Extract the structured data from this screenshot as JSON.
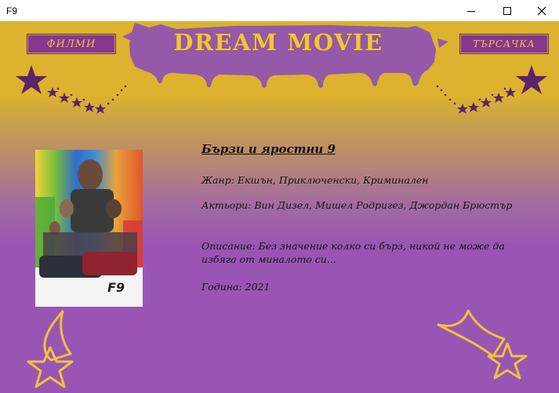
{
  "window": {
    "title": "F9"
  },
  "header": {
    "brand": "DREAM MOVIE",
    "nav_films": "ФИЛМИ",
    "nav_search": "ТЪРСАЧКА"
  },
  "poster": {
    "title_text": "F9"
  },
  "movie": {
    "title": "Бързи и яростни 9",
    "genre": "Жанр: Екшън, Приключенски, Криминален",
    "actors": "Актьори:  Вин Дизел, Мишел Родригез, Джордан Брюстър",
    "description": "Описание: Без значение колко си бърз, никой не може да избяга от миналото си...",
    "year": "Година: 2021"
  },
  "colors": {
    "top_gold": "#dcb22e",
    "purple_bg": "#9a55b4",
    "banner_purple": "#9658a8",
    "nav_purple": "#86378f",
    "gold_text": "#efc23b",
    "star_purple": "#5d2368"
  }
}
